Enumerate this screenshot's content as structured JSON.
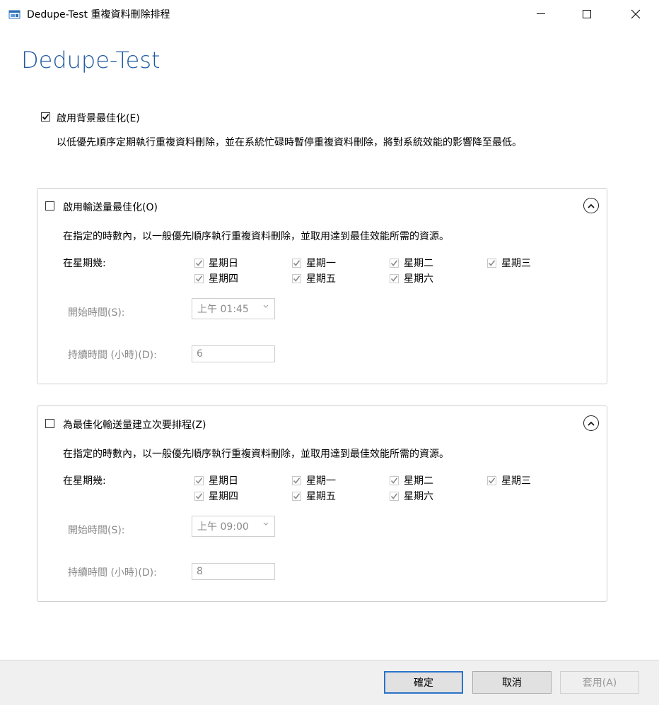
{
  "window": {
    "title": "Dedupe-Test 重複資料刪除排程",
    "icon": "dedupe-app-icon",
    "controls": {
      "minimize": "minimize-icon",
      "maximize": "maximize-icon",
      "close": "close-icon"
    }
  },
  "heading": "Dedupe-Test",
  "background_opt": {
    "label": "啟用背景最佳化(E)",
    "checked": true,
    "description": "以低優先順序定期執行重複資料刪除，並在系統忙碌時暫停重複資料刪除，將對系統效能的影響降至最低。"
  },
  "throughput_opt": {
    "label": "啟用輸送量最佳化(O)",
    "checked": false,
    "description": "在指定的時數內，以一般優先順序執行重複資料刪除，並取用達到最佳效能所需的資源。",
    "days_label": "在星期幾:",
    "days": [
      "星期日",
      "星期一",
      "星期二",
      "星期三",
      "星期四",
      "星期五",
      "星期六"
    ],
    "days_checked": [
      true,
      true,
      true,
      true,
      true,
      true,
      true
    ],
    "start_label": "開始時間(S):",
    "start_value": "上午 01:45",
    "duration_label": "持續時間 (小時)(D):",
    "duration_value": "6"
  },
  "secondary_opt": {
    "label": "為最佳化輸送量建立次要排程(Z)",
    "checked": false,
    "description": "在指定的時數內，以一般優先順序執行重複資料刪除，並取用達到最佳效能所需的資源。",
    "days_label": "在星期幾:",
    "days": [
      "星期日",
      "星期一",
      "星期二",
      "星期三",
      "星期四",
      "星期五",
      "星期六"
    ],
    "days_checked": [
      true,
      true,
      true,
      true,
      true,
      true,
      true
    ],
    "start_label": "開始時間(S):",
    "start_value": "上午 09:00",
    "duration_label": "持續時間 (小時)(D):",
    "duration_value": "8"
  },
  "buttons": {
    "ok": "確定",
    "cancel": "取消",
    "apply": "套用(A)"
  },
  "colors": {
    "heading": "#1f5aa0",
    "default_button_border": "#2b73c8",
    "footer_bg": "#f0f0f0"
  }
}
